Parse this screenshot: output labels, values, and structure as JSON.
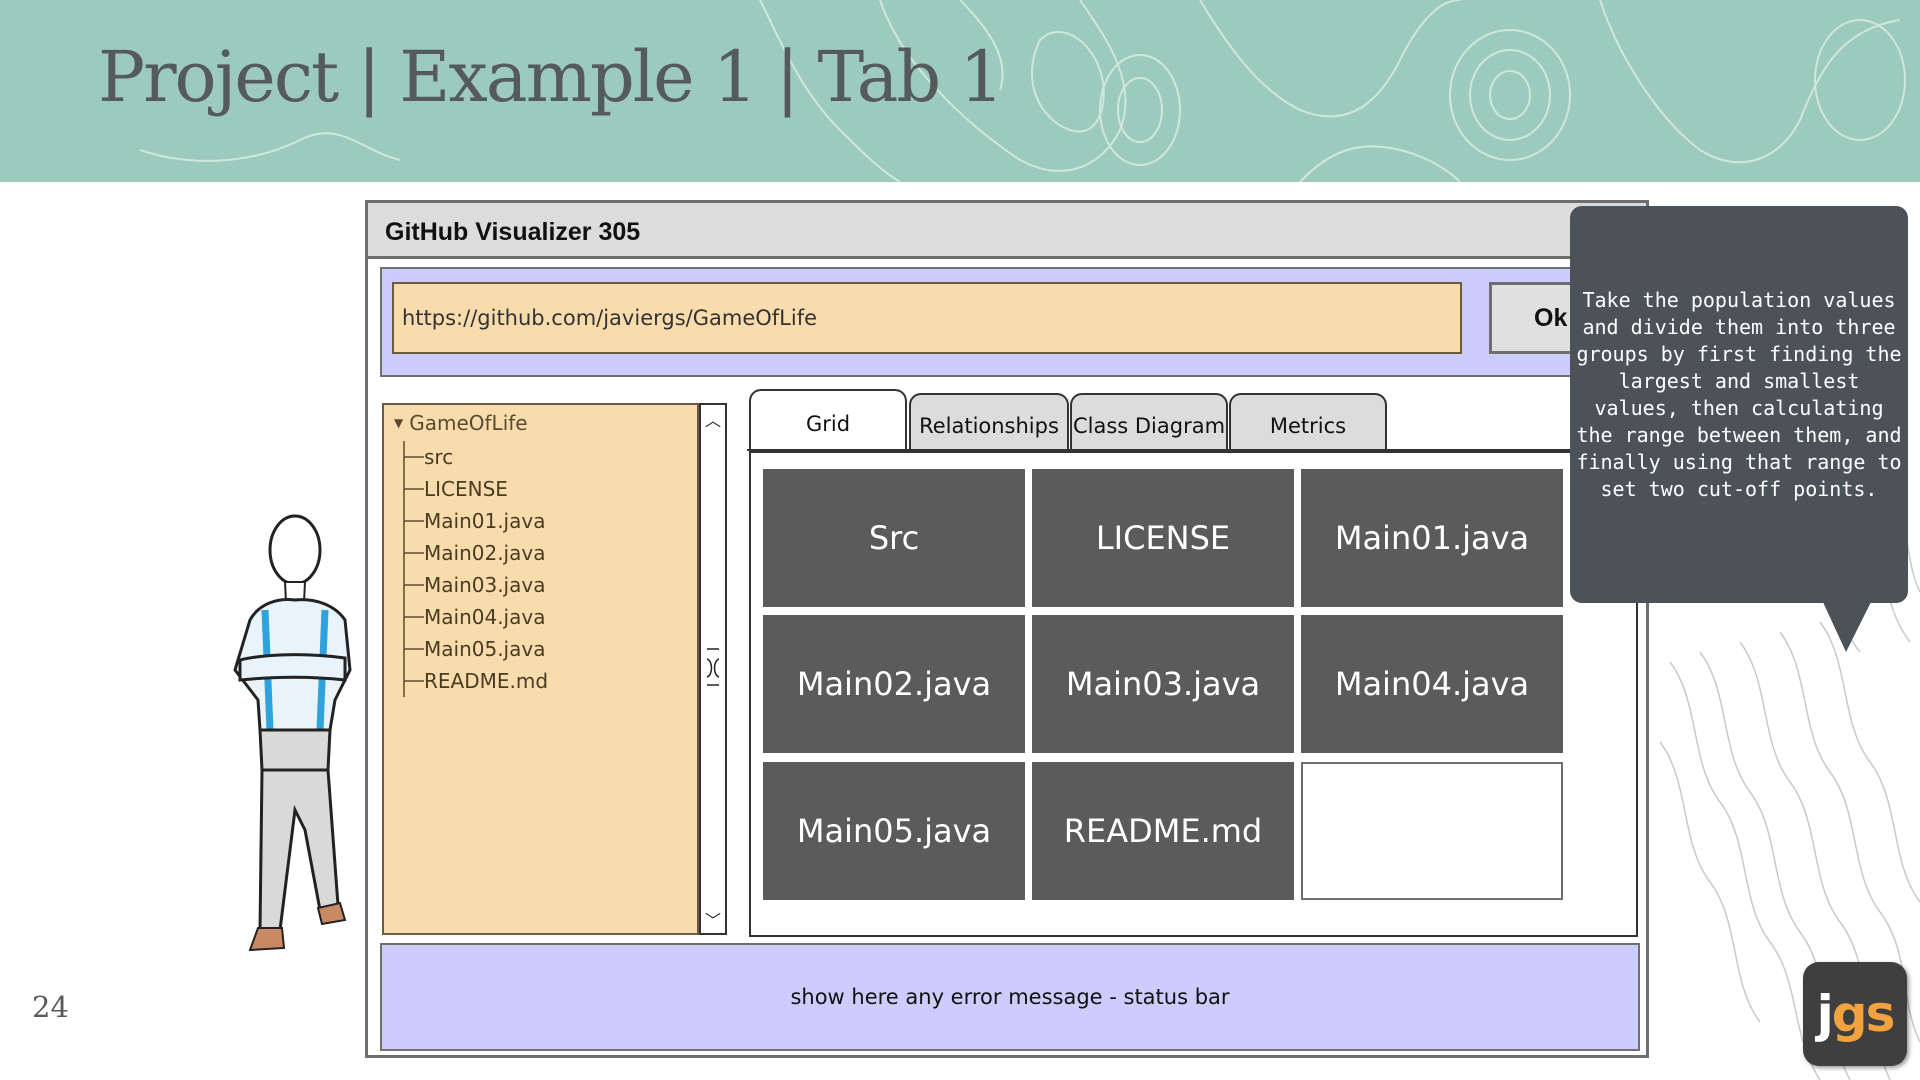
{
  "slide": {
    "title": "Project | Example 1 | Tab 1",
    "page_number": "24"
  },
  "window": {
    "title": "GitHub Visualizer 305",
    "url_value": "https://github.com/javiergs/GameOfLife",
    "ok_label": "Ok"
  },
  "tree": {
    "root": "GameOfLife",
    "items": [
      "src",
      "LICENSE",
      "Main01.java",
      "Main02.java",
      "Main03.java",
      "Main04.java",
      "Main05.java",
      "README.md"
    ]
  },
  "tabs": [
    {
      "label": "Grid",
      "active": true
    },
    {
      "label": "Relationships",
      "active": false
    },
    {
      "label": "Class Diagram",
      "active": false
    },
    {
      "label": "Metrics",
      "active": false
    }
  ],
  "grid": {
    "cells": [
      "Src",
      "LICENSE",
      "Main01.java",
      "Main02.java",
      "Main03.java",
      "Main04.java",
      "Main05.java",
      "README.md",
      ""
    ]
  },
  "status_bar": {
    "text": "show here any error message - status bar"
  },
  "tooltip": {
    "text": "Take the population values and divide them into three groups by first finding the largest and smallest values, then calculating the range between them, and finally using that range to set two cut-off points."
  },
  "logo": {
    "j": "j",
    "g": "g",
    "s": "s"
  },
  "colors": {
    "header": "#9ccabc",
    "panel_blue": "#ccccfd",
    "panel_beige": "#f8dcad",
    "cell_gray": "#5b5b5b",
    "tooltip": "#4b5258",
    "logo_accent": "#f2a23e"
  },
  "icons": {
    "tree_caret": "caret-down-icon",
    "scroll_up": "chevron-up-icon",
    "scroll_down": "chevron-down-icon"
  }
}
